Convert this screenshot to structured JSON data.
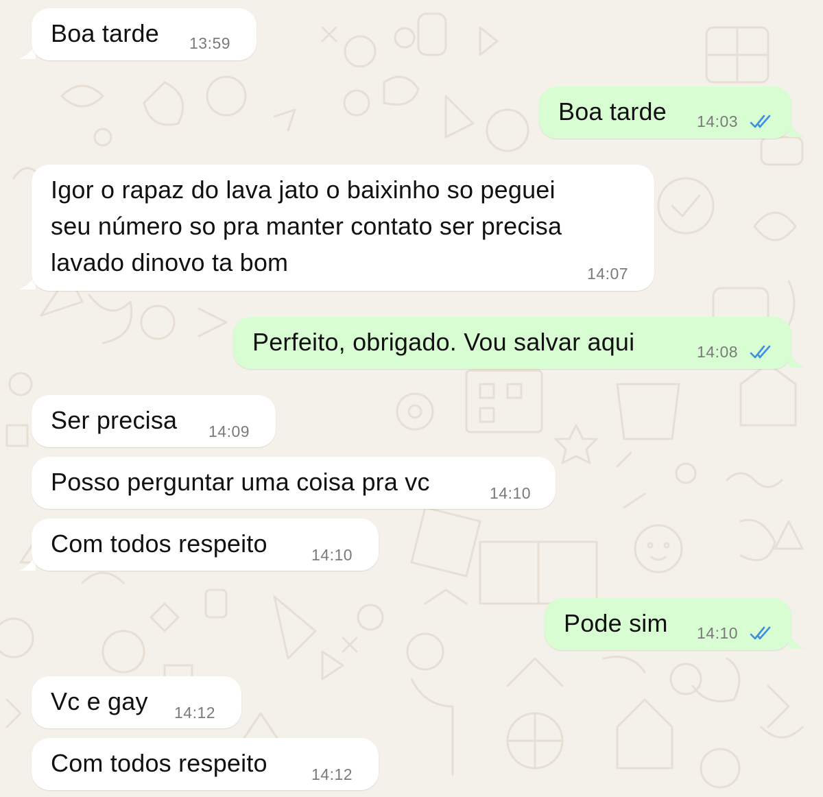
{
  "colors": {
    "wallpaper": "#f4f0ea",
    "incoming_bubble": "#ffffff",
    "outgoing_bubble": "#d9fdd3",
    "timestamp": "#7a7a7a",
    "read_ticks": "#3a8fe0"
  },
  "icons": {
    "read_receipt": "double-check-icon"
  },
  "messages": [
    {
      "direction": "incoming",
      "text": "Boa tarde",
      "time": "13:59"
    },
    {
      "direction": "outgoing",
      "text": "Boa tarde",
      "time": "14:03",
      "status": "read"
    },
    {
      "direction": "incoming",
      "lines": [
        "Igor o rapaz do lava jato o baixinho so peguei",
        "seu número so pra manter contato  ser precisa",
        "lavado dinovo ta bom"
      ],
      "time": "14:07"
    },
    {
      "direction": "outgoing",
      "text": "Perfeito, obrigado. Vou salvar aqui",
      "time": "14:08",
      "status": "read"
    },
    {
      "direction": "incoming",
      "text": "Ser precisa",
      "time": "14:09"
    },
    {
      "direction": "incoming",
      "text": "Posso perguntar uma coisa pra vc",
      "time": "14:10"
    },
    {
      "direction": "incoming",
      "text": "Com todos respeito",
      "time": "14:10"
    },
    {
      "direction": "outgoing",
      "text": "Pode sim",
      "time": "14:10",
      "status": "read"
    },
    {
      "direction": "incoming",
      "text": "Vc e gay",
      "time": "14:12"
    },
    {
      "direction": "incoming",
      "text": "Com todos respeito",
      "time": "14:12"
    }
  ]
}
